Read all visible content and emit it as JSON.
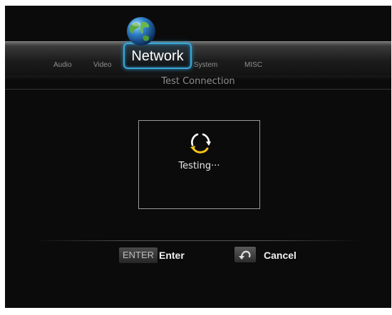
{
  "tabs": [
    {
      "label": "Audio",
      "active": false
    },
    {
      "label": "Video",
      "active": false
    },
    {
      "label": "Network",
      "active": true
    },
    {
      "label": "System",
      "active": false
    },
    {
      "label": "MISC",
      "active": false
    }
  ],
  "page": {
    "subtitle": "Test Connection"
  },
  "dialog": {
    "status_text": "Testing···",
    "icon": "refresh-spinner-icon"
  },
  "footer": {
    "enter_key": "ENTER",
    "enter_label": "Enter",
    "back_icon": "return-arrow-icon",
    "cancel_label": "Cancel"
  },
  "colors": {
    "accent": "#3aa7d6",
    "spinner_white": "#ffffff",
    "spinner_yellow": "#f2c21a",
    "background": "#0b0b0b"
  }
}
